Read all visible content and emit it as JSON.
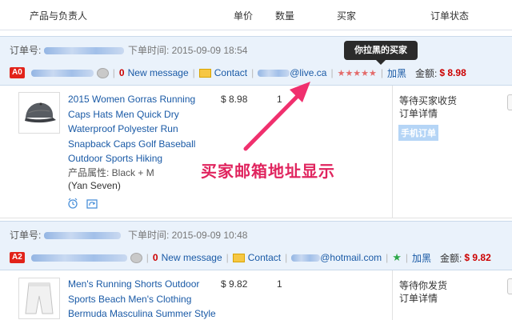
{
  "header": {
    "col_product": "产品与负责人",
    "col_price": "单价",
    "col_qty": "数量",
    "col_buyer": "买家",
    "col_status": "订单状态"
  },
  "tooltip": "你拉黑的买家",
  "annotation": "买家邮箱地址显示",
  "orders": [
    {
      "order_no_label": "订单号:",
      "order_time": "下单时间: 2015-09-09 18:54",
      "badge": "A0",
      "new_message": "New message",
      "message_count": "0",
      "contact": "Contact",
      "email": "@live.ca",
      "stars": "★★★★★",
      "blacklist": "加黑",
      "amount_label": "金额:",
      "amount": "$ 8.98",
      "product_title": "2015 Women Gorras Running Caps Hats Men Quick Dry Waterproof Polyester Run Snapback Caps Golf Baseball Outdoor Sports Hiking",
      "attr": "产品属性: Black   + M",
      "owner": "(Yan Seven)",
      "price": "$ 8.98",
      "qty": "1",
      "status_text": "等待买家收货",
      "detail_link": "订单详情",
      "mobile_tag": "手机订单"
    },
    {
      "order_no_label": "订单号:",
      "order_time": "下单时间: 2015-09-09 10:48",
      "badge": "A2",
      "new_message": "New message",
      "message_count": "0",
      "contact": "Contact",
      "email": "@hotmail.com",
      "stars": "★",
      "blacklist": "加黑",
      "amount_label": "金额:",
      "amount": "$ 9.82",
      "product_title": "Men's Running Shorts Outdoor Sports Beach Men's Clothing Bermuda Masculina Summer Style",
      "price": "$ 9.82",
      "qty": "1",
      "status_text": "等待你发货",
      "detail_link": "订单详情"
    }
  ],
  "colors": {
    "accent_link": "#1a5aa6",
    "price_red": "#cc0000",
    "order_head_bg": "#eaf2fb",
    "annotation_pink": "#e0245e"
  }
}
